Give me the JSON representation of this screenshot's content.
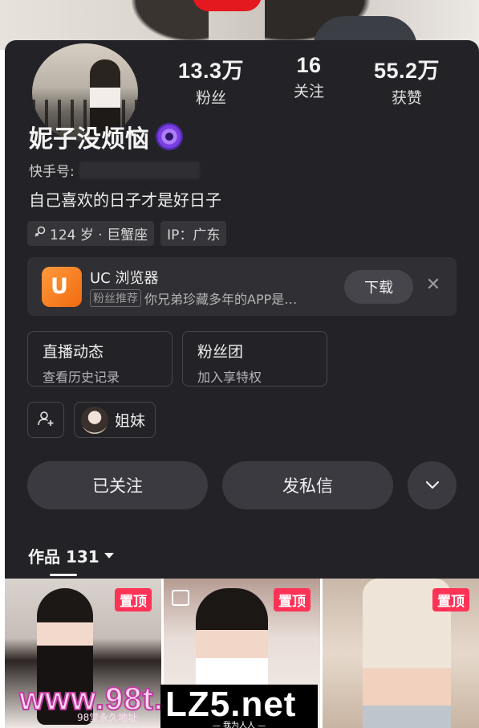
{
  "profile": {
    "stats": [
      {
        "value": "13.3万",
        "label": "粉丝"
      },
      {
        "value": "16",
        "label": "关注"
      },
      {
        "value": "55.2万",
        "label": "获赞"
      }
    ],
    "name": "妮子没烦恼",
    "kuaishou_id_label": "快手号:",
    "bio": "自己喜欢的日子才是好日子",
    "tags": [
      {
        "icon": "female-icon",
        "text": "124 岁 · 巨蟹座"
      },
      {
        "text": "IP：广东"
      }
    ]
  },
  "ad": {
    "app_name": "UC 浏览器",
    "label": "粉丝推荐",
    "text": "你兄弟珍藏多年的APP是…",
    "download_label": "下载",
    "close": "✕"
  },
  "cards": [
    {
      "title": "直播动态",
      "subtitle": "查看历史记录"
    },
    {
      "title": "粉丝团",
      "subtitle": "加入享特权"
    }
  ],
  "friends": {
    "chip_label": "姐妹"
  },
  "actions": {
    "followed_label": "已关注",
    "message_label": "发私信"
  },
  "works": {
    "label": "作品 131"
  },
  "grid": [
    {
      "pin": "置顶"
    },
    {
      "pin": "置顶"
    },
    {
      "pin": "置顶"
    }
  ],
  "watermarks": {
    "wm1": "www.98t.",
    "wm1_sub": "98堂永久地址",
    "wm2": "LZ5.net",
    "wm2_sub": "— 我为人人 —"
  },
  "colors": {
    "panel_bg": "#232327",
    "pin_red": "#fe3356",
    "uc_orange": "#f26a10"
  }
}
